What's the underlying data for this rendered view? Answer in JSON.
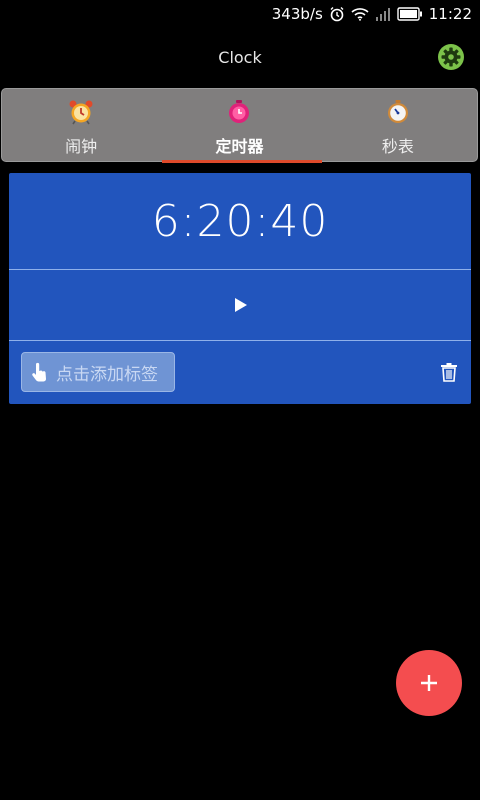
{
  "status_bar": {
    "network_speed": "343b/s",
    "time": "11:22",
    "icons": [
      "alarm-clock-icon",
      "wifi-icon",
      "signal-icon",
      "battery-icon"
    ]
  },
  "header": {
    "title": "Clock",
    "settings_icon": "gear-icon"
  },
  "tabs": [
    {
      "label": "闹钟",
      "icon": "alarm-clock-icon",
      "active": false
    },
    {
      "label": "定时器",
      "icon": "timer-icon",
      "active": true
    },
    {
      "label": "秒表",
      "icon": "stopwatch-icon",
      "active": false
    }
  ],
  "timer": {
    "time": "6:20:40",
    "play_icon": "play-icon",
    "label_placeholder": "点击添加标签",
    "delete_icon": "trash-icon"
  },
  "fab": {
    "label": "+",
    "icon": "add-icon"
  },
  "colors": {
    "background": "#000000",
    "tab_bar": "#807e7e",
    "tab_indicator": "#e04a2a",
    "card": "#2255bd",
    "fab": "#f44d4f",
    "settings": "#7cc24a"
  }
}
